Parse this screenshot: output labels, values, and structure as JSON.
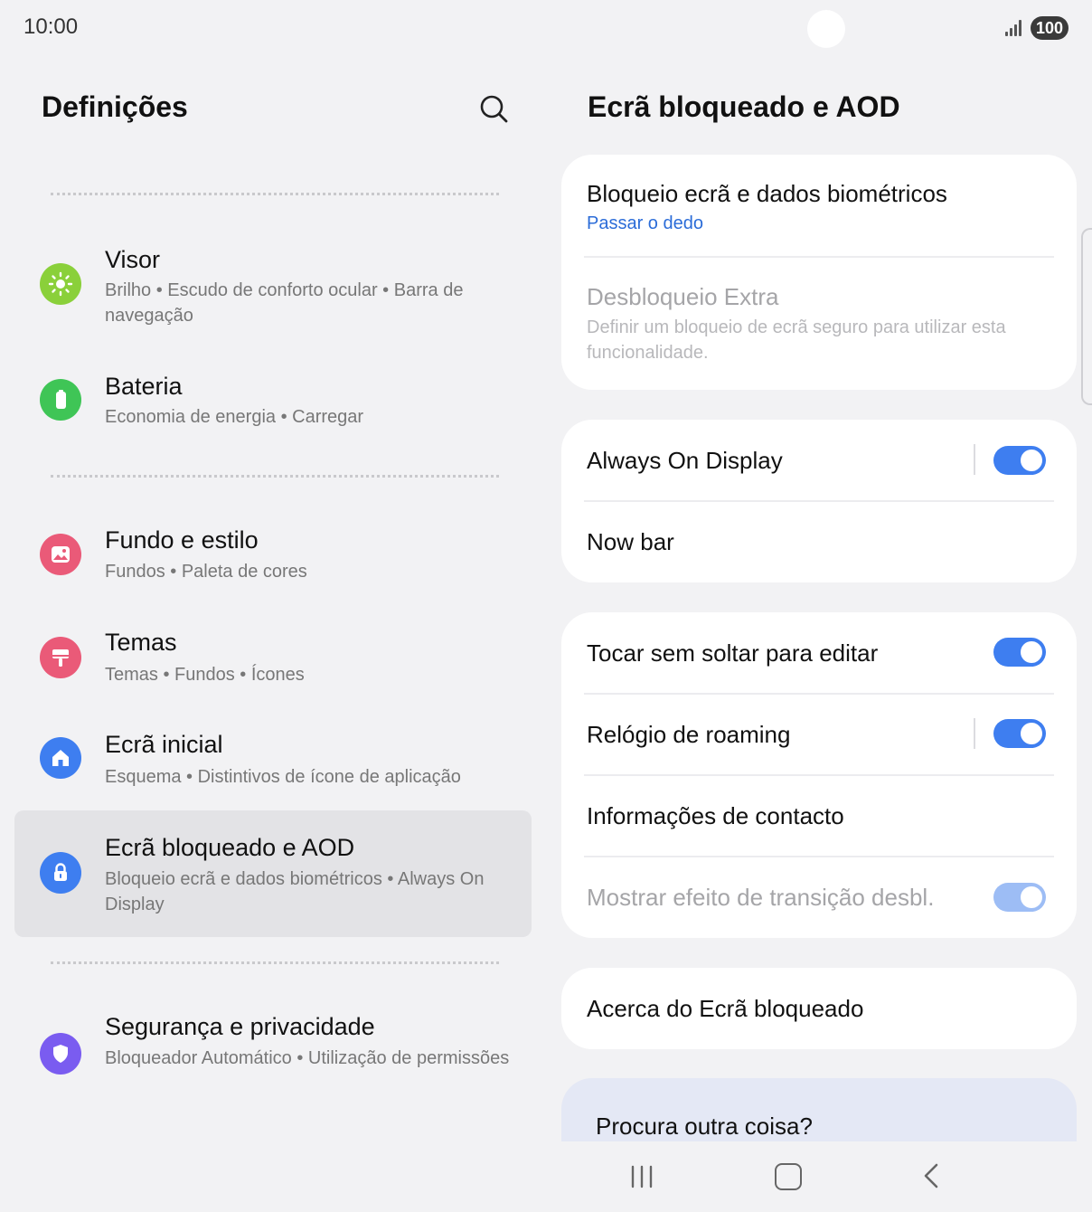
{
  "status": {
    "time": "10:00",
    "battery": "100"
  },
  "left": {
    "title": "Definições",
    "items": [
      {
        "title": "Visor",
        "subtitle": "Brilho  •  Escudo de conforto ocular  •  Barra de navegação",
        "icon": "sun-icon",
        "color": "#8ad03a"
      },
      {
        "title": "Bateria",
        "subtitle": "Economia de energia  •  Carregar",
        "icon": "battery-icon",
        "color": "#3fc556"
      },
      {
        "title": "Fundo e estilo",
        "subtitle": "Fundos  •  Paleta de cores",
        "icon": "image-icon",
        "color": "#ea5a78"
      },
      {
        "title": "Temas",
        "subtitle": "Temas  •  Fundos  •  Ícones",
        "icon": "paint-brush-icon",
        "color": "#ea5a78"
      },
      {
        "title": "Ecrã inicial",
        "subtitle": "Esquema  •  Distintivos de ícone de aplicação",
        "icon": "home-icon",
        "color": "#3e7ef0"
      },
      {
        "title": "Ecrã bloqueado e AOD",
        "subtitle": "Bloqueio ecrã e dados biométricos  •  Always On Display",
        "icon": "lock-icon",
        "color": "#3e7ef0",
        "selected": true
      },
      {
        "title": "Segurança e privacidade",
        "subtitle": "Bloqueador Automático  •  Utilização de permissões",
        "icon": "shield-icon",
        "color": "#7a5cf0"
      }
    ]
  },
  "right": {
    "title": "Ecrã bloqueado e AOD",
    "card1": {
      "lock_title": "Bloqueio ecrã e dados biométricos",
      "lock_sub": "Passar o dedo",
      "extra_title": "Desbloqueio Extra",
      "extra_sub": "Definir um bloqueio de ecrã seguro para utilizar esta funcionalidade."
    },
    "card2": {
      "aod": "Always On Display",
      "aod_on": true,
      "nowbar": "Now bar"
    },
    "card3": {
      "touch_edit": "Tocar sem soltar para editar",
      "roaming_clock": "Relógio de roaming",
      "contact_info": "Informações de contacto",
      "transition": "Mostrar efeito de transição desbl."
    },
    "card4": {
      "about": "Acerca do Ecrã bloqueado"
    },
    "looking": "Procura outra coisa?"
  },
  "colors": {
    "accent": "#3e7ef0",
    "link": "#2b6cd8"
  }
}
